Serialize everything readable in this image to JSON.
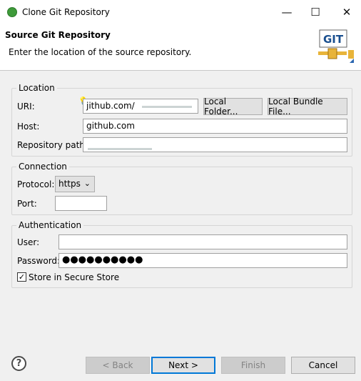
{
  "window": {
    "title": "Clone Git Repository",
    "minimize_icon": "minimize-icon",
    "maximize_icon": "maximize-icon",
    "close_icon": "close-icon"
  },
  "header": {
    "title": "Source Git Repository",
    "description": "Enter the location of the source repository.",
    "banner_text": "GIT"
  },
  "location": {
    "legend": "Location",
    "uri_label": "URI:",
    "uri_value": "jithub.com/",
    "local_folder_label": "Local Folder...",
    "local_bundle_label": "Local Bundle File...",
    "host_label": "Host:",
    "host_value": "github.com",
    "repo_path_label": "Repository path:",
    "repo_path_value": ""
  },
  "connection": {
    "legend": "Connection",
    "protocol_label": "Protocol:",
    "protocol_value": "https",
    "port_label": "Port:",
    "port_value": ""
  },
  "authentication": {
    "legend": "Authentication",
    "user_label": "User:",
    "user_value": "",
    "password_label": "Password:",
    "password_value": "●●●●●●●●●●",
    "store_label": "Store in Secure Store",
    "store_checked": true
  },
  "footer": {
    "help_icon": "help-icon",
    "back_label": "< Back",
    "next_label": "Next >",
    "finish_label": "Finish",
    "cancel_label": "Cancel"
  }
}
